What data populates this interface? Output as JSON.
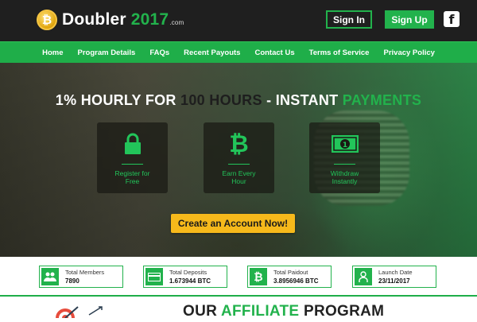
{
  "header": {
    "brand_main": "Doubler ",
    "brand_year": "2017",
    "brand_tld": ".com",
    "signin_label": "Sign In",
    "signup_label": "Sign Up",
    "facebook_glyph": "f"
  },
  "nav": {
    "items": [
      {
        "label": "Home"
      },
      {
        "label": "Program Details"
      },
      {
        "label": "FAQs"
      },
      {
        "label": "Recent Payouts"
      },
      {
        "label": "Contact Us"
      },
      {
        "label": "Terms of Service"
      },
      {
        "label": "Privacy Policy"
      }
    ]
  },
  "hero": {
    "title_part1": "1% HOURLY FOR ",
    "title_part2": "100 HOURS",
    "title_part3": " - INSTANT ",
    "title_part4": "PAYMENTS",
    "features": [
      {
        "label_line1": "Register for",
        "label_line2": "Free",
        "icon": "lock-icon"
      },
      {
        "label_line1": "Earn Every",
        "label_line2": "Hour",
        "icon": "bitcoin-icon"
      },
      {
        "label_line1": "Withdraw",
        "label_line2": "Instantly",
        "icon": "banknote-icon"
      }
    ],
    "cta_label": "Create an Account Now!"
  },
  "stats": [
    {
      "title": "Total Members",
      "value": "7890",
      "icon": "members-icon"
    },
    {
      "title": "Total Deposits",
      "value": "1.673944 BTC",
      "icon": "card-icon"
    },
    {
      "title": "Total Paidout",
      "value": "3.8956946 BTC",
      "icon": "bitcoin-icon"
    },
    {
      "title": "Launch Date",
      "value": "23/11/2017",
      "icon": "user-icon"
    }
  ],
  "affiliate": {
    "title_part1": "OUR ",
    "title_part2": "AFFILIATE",
    "title_part3": " PROGRAM"
  },
  "colors": {
    "accent": "#22b24c",
    "header_bg": "#1f1f1f",
    "cta": "#f6b91b"
  }
}
